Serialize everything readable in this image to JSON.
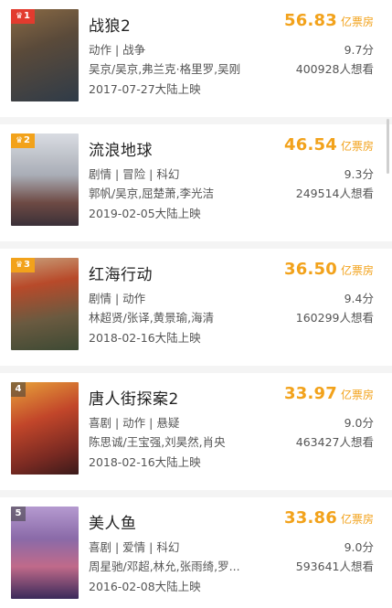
{
  "movies": [
    {
      "rank": "1",
      "badge_type": "crown",
      "title": "战狼2",
      "box_office": "56.83",
      "unit": "亿票房",
      "genre": "动作 | 战争",
      "score": "9.7分",
      "cast": "吴京/吴京,弗兰克·格里罗,吴刚",
      "wish": "400928人想看",
      "release": "2017-07-27大陆上映",
      "poster_colors": [
        "#7a5a3a",
        "#3b4a5a"
      ]
    },
    {
      "rank": "2",
      "badge_type": "crown",
      "title": "流浪地球",
      "box_office": "46.54",
      "unit": "亿票房",
      "genre": "剧情 | 冒险 | 科幻",
      "score": "9.3分",
      "cast": "郭帆/吴京,屈楚萧,李光洁",
      "wish": "249514人想看",
      "release": "2019-02-05大陆上映",
      "poster_colors": [
        "#c9ccd2",
        "#6a4a46"
      ]
    },
    {
      "rank": "3",
      "badge_type": "crown",
      "title": "红海行动",
      "box_office": "36.50",
      "unit": "亿票房",
      "genre": "剧情 | 动作",
      "score": "9.4分",
      "cast": "林超贤/张译,黄景瑜,海清",
      "wish": "160299人想看",
      "release": "2018-02-16大陆上映",
      "poster_colors": [
        "#b84a2a",
        "#4a5a3a"
      ]
    },
    {
      "rank": "4",
      "badge_type": "plain",
      "title": "唐人街探案2",
      "box_office": "33.97",
      "unit": "亿票房",
      "genre": "喜剧 | 动作 | 悬疑",
      "score": "9.0分",
      "cast": "陈思诚/王宝强,刘昊然,肖央",
      "wish": "463427人想看",
      "release": "2018-02-16大陆上映",
      "poster_colors": [
        "#c2462a",
        "#e8a23a"
      ]
    },
    {
      "rank": "5",
      "badge_type": "plain",
      "title": "美人鱼",
      "box_office": "33.86",
      "unit": "亿票房",
      "genre": "喜剧 | 爱情 | 科幻",
      "score": "9.0分",
      "cast": "周星驰/邓超,林允,张雨绮,罗...",
      "wish": "593641人想看",
      "release": "2016-02-08大陆上映",
      "poster_colors": [
        "#8a6aa8",
        "#3a2a5a"
      ]
    }
  ],
  "colors": {
    "box_office": "#f2a21b",
    "rank1_badge": "#e23b2e",
    "top_badge": "#f2a21b"
  }
}
